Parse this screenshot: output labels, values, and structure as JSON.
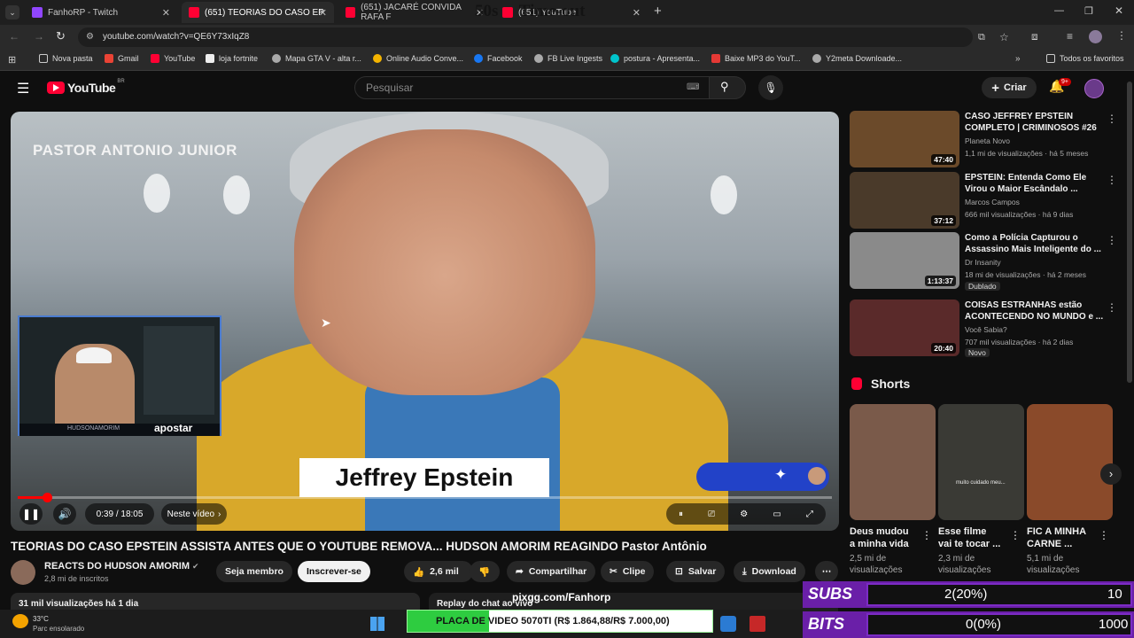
{
  "browser": {
    "tabs": [
      {
        "title": "FanhoRP - Twitch",
        "color": "#9146ff"
      },
      {
        "title": "(651) TEORIAS DO CASO EP",
        "color": "#ff0033"
      },
      {
        "title": "(651) JACARÉ CONVIDA RAFA F",
        "color": "#ff0033"
      },
      {
        "title": "(651) YouTube",
        "color": "#ff0033"
      }
    ],
    "overlay_text": "50s     Time-out",
    "url": "youtube.com/watch?v=QE6Y73xIqZ8",
    "bookmarks": [
      "Nova pasta",
      "Gmail",
      "YouTube",
      "loja fortnite",
      "Mapa GTA V - alta r...",
      "Online Audio Conve...",
      "Facebook",
      "FB Live Ingests",
      "postura - Apresenta...",
      "Baixe MP3 do YouT...",
      "Y2meta Downloade..."
    ],
    "bookmarks_all": "Todos os favoritos"
  },
  "yt": {
    "logo": "YouTube",
    "region": "BR",
    "search_placeholder": "Pesquisar",
    "create": "Criar",
    "notif_badge": "9+"
  },
  "player": {
    "overlay_top": "PASTOR ANTONIO JUNIOR",
    "lower_third": "Jeffrey Epstein",
    "cam_label": "HUDSONAMORIM",
    "cam_brand": "apostar",
    "time": "0:39 / 18:05",
    "next": "Neste vídeo",
    "progress_fraction": 0.036
  },
  "video": {
    "title": "TEORIAS DO CASO EPSTEIN ASSISTA ANTES QUE O YOUTUBE REMOVA... HUDSON AMORIM REAGINDO Pastor Antônio",
    "channel": "REACTS DO HUDSON AMORIM",
    "subs": "2,8 mi de inscritos",
    "member": "Seja membro",
    "subscribe": "Inscrever-se",
    "likes": "2,6 mil",
    "share": "Compartilhar",
    "clip": "Clipe",
    "save": "Salvar",
    "download": "Download",
    "views": "31 mil visualizações",
    "age": "há 1 dia",
    "chat_replay": "Replay do chat ao vivo"
  },
  "recs": [
    {
      "title": "CASO JEFFREY EPSTEIN COMPLETO | CRIMINOSOS #26",
      "channel": "Planeta Novo",
      "meta": "1,1 mi de visualizações · há 5 meses",
      "dur": "47:40",
      "color": "#6b4a2a"
    },
    {
      "title": "EPSTEIN: Entenda Como Ele Virou o Maior Escândalo ...",
      "channel": "Marcos Campos",
      "meta": "666 mil visualizações · há 9 dias",
      "dur": "37:12",
      "color": "#4a3a2a"
    },
    {
      "title": "Como a Polícia Capturou o Assassino Mais Inteligente do ...",
      "channel": "Dr Insanity",
      "meta": "18 mi de visualizações · há 2 meses",
      "dur": "1:13:37",
      "badge": "Dublado",
      "color": "#8a8a8a"
    },
    {
      "title": "COISAS ESTRANHAS estão ACONTECENDO NO MUNDO e ...",
      "channel": "Você Sabia?",
      "meta": "707 mil visualizações · há 2 dias",
      "dur": "20:40",
      "badge": "Novo",
      "color": "#5a2a2a"
    }
  ],
  "shorts": {
    "heading": "Shorts",
    "items": [
      {
        "title1": "Deus mudou",
        "title2": "a minha vida",
        "views1": "2,5 mi de",
        "views2": "visualizações",
        "color": "#7a5a4a"
      },
      {
        "title1": "Esse filme",
        "title2": "vai te tocar ...",
        "views1": "2,3 mi de",
        "views2": "visualizações",
        "caption": "muito cuidado meu...",
        "color": "#3a3a35"
      },
      {
        "title1": "FIC A MINHA",
        "title2": "CARNE ...",
        "views1": "5,1 mi de",
        "views2": "visualizações",
        "color": "#8a4a2a"
      }
    ]
  },
  "stream": {
    "pix": "pixgg.com/Fanhorp",
    "goal_label": "PLACA DE VIDEO 5070TI (R$ 1.864,88/R$ 7.000,00)",
    "goal_fraction": 0.266,
    "subs_label": "SUBS",
    "subs_value": "2(20%)",
    "subs_goal": "10",
    "bits_label": "BITS",
    "bits_value": "0(0%)",
    "bits_goal": "1000",
    "weather_temp": "33°C",
    "weather_desc": "Parc ensolarado"
  }
}
